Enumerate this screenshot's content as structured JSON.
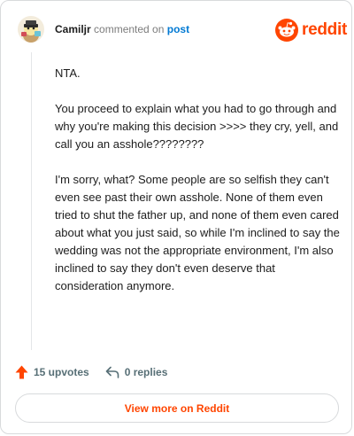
{
  "header": {
    "username": "Camiljr",
    "action_text": "commented on",
    "post_link": "post"
  },
  "brand": {
    "name": "reddit",
    "color": "#ff4500"
  },
  "comment": {
    "paragraphs": [
      "NTA.",
      "You proceed to explain what you had to go through and why you're making this decision >>>> they cry, yell, and call you an asshole????????",
      "I'm sorry, what? Some people are so selfish they can't even see past their own asshole. None of them even tried to shut the father up, and none of them even cared about what you just said, so while I'm inclined to say the wedding was not the appropriate environment, I'm also inclined to say they don't even deserve that consideration anymore."
    ]
  },
  "actions": {
    "upvotes": "15 upvotes",
    "replies": "0 replies"
  },
  "footer": {
    "view_more": "View more on Reddit"
  },
  "icons": {
    "avatar": "snoo-avatar-icon",
    "logo": "reddit-snoo-icon",
    "upvote": "upvote-arrow-icon",
    "reply": "reply-arrow-icon"
  }
}
